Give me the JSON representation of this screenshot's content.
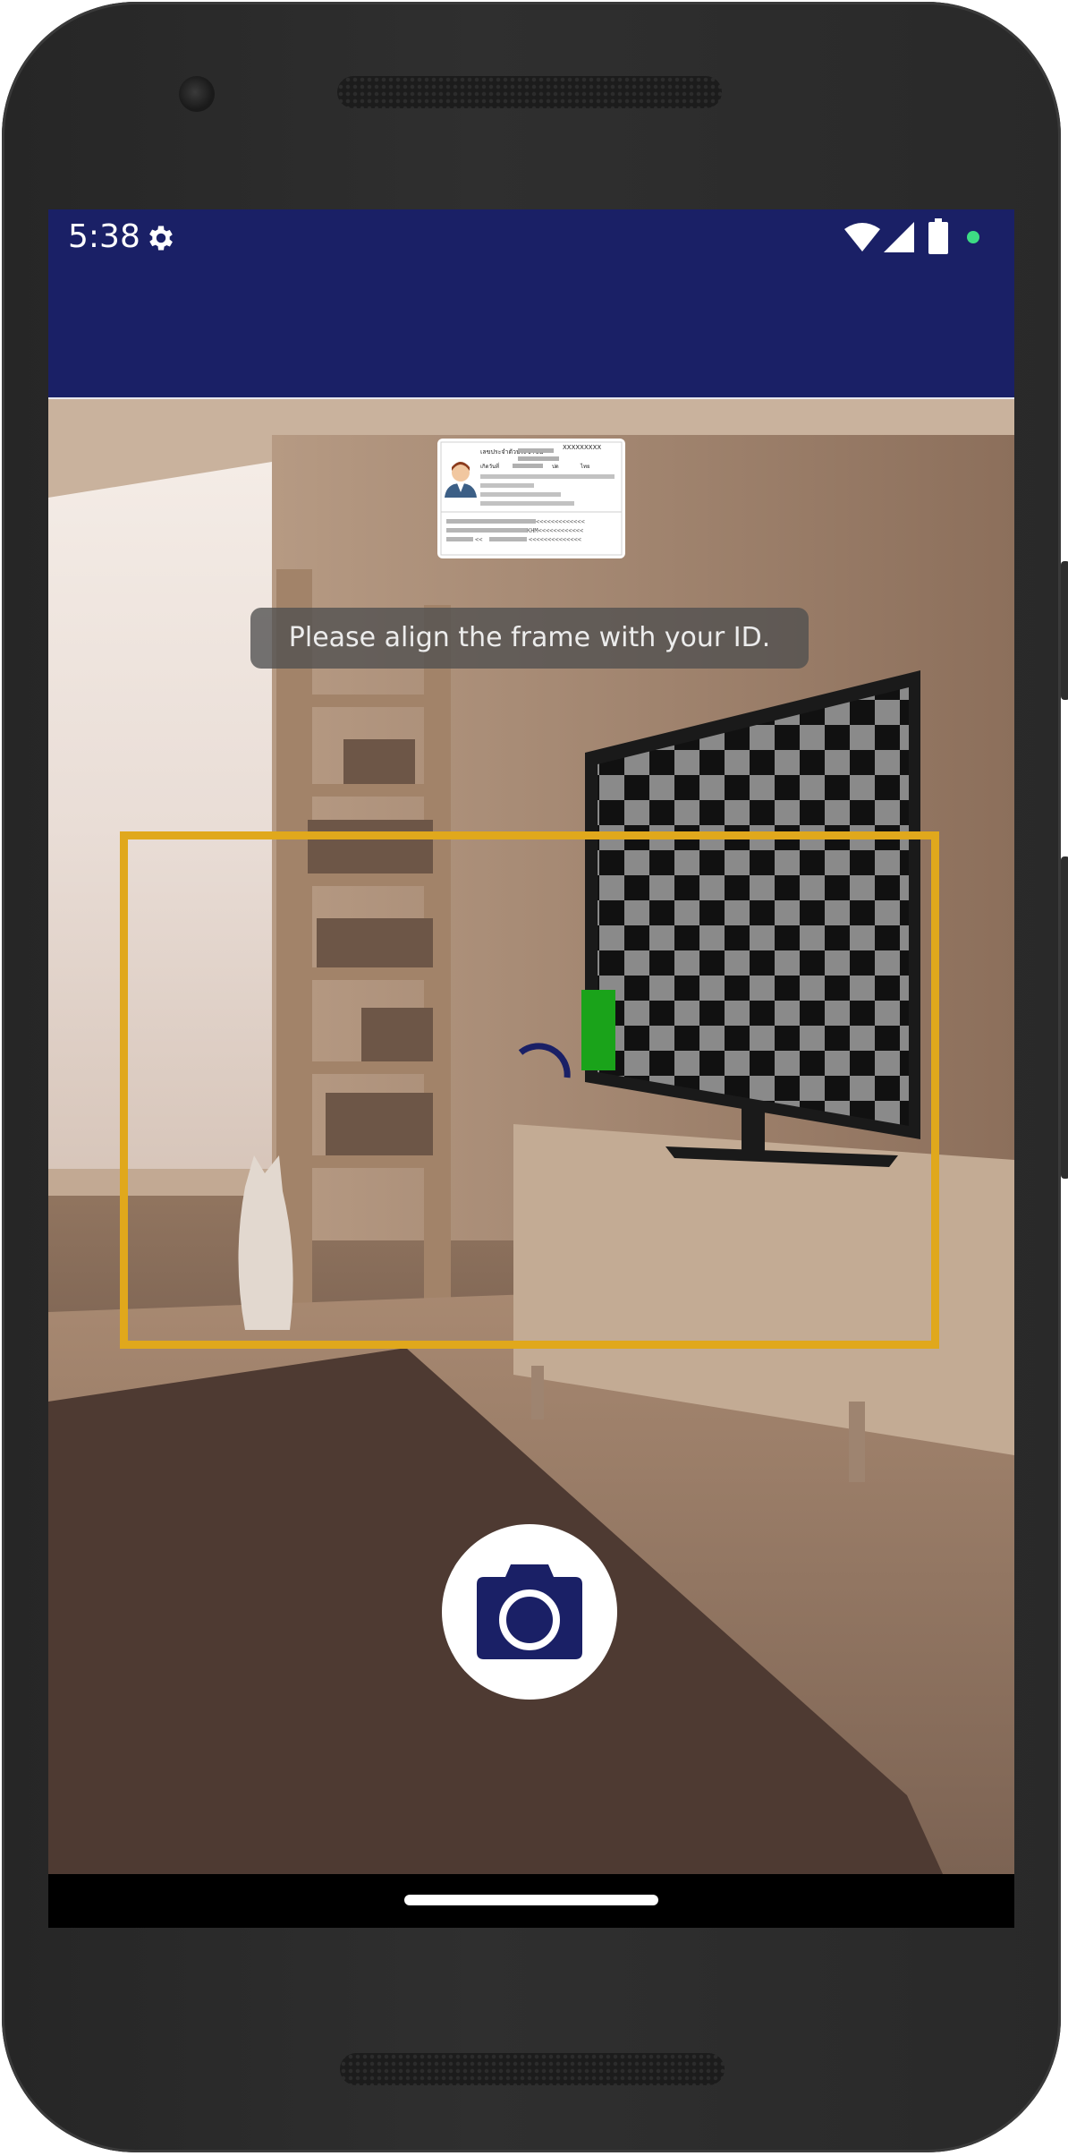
{
  "status_bar": {
    "time": "5:38",
    "icons": [
      "gear-icon",
      "wifi-icon",
      "signal-icon",
      "battery-icon",
      "notification-dot-icon"
    ],
    "notification_dot_color": "#3ddc84"
  },
  "app_bar": {
    "background_color": "#1a2066"
  },
  "scanner": {
    "hint": "Please align the frame with your ID.",
    "frame_color": "#e0a81c",
    "id_card": {
      "header_label": "เลขประจำตัวประชาชน",
      "number": "XXXXXXXXX",
      "label_birth": "เกิดวันที่",
      "label_1": "ปด",
      "label_2": "ไทย",
      "mrz_line_1": "<<<<<<<<<<<<<",
      "mrz_line_2": "KHM<<<<<<<<<<<<",
      "mrz_line_3": "<<",
      "mrz_line_4": "<<<<<<<<<<<<<<"
    },
    "accent_color": "#1a2066"
  },
  "capture": {
    "icon": "camera-icon"
  }
}
